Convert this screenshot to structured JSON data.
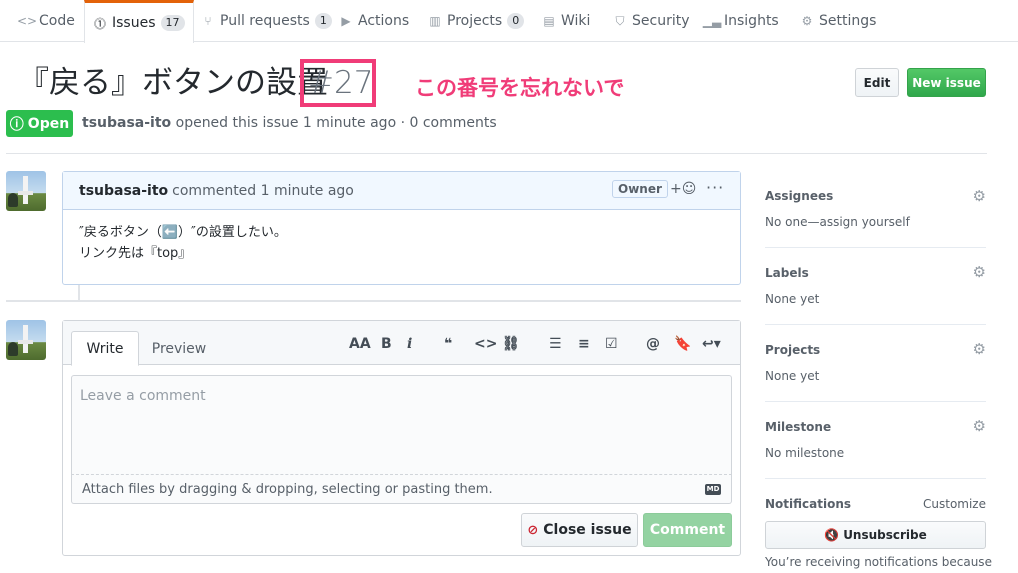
{
  "nav": {
    "tabs": [
      {
        "label": "Code",
        "icon": "code-icon"
      },
      {
        "label": "Issues",
        "icon": "issue-opened-icon",
        "count": "17"
      },
      {
        "label": "Pull requests",
        "icon": "git-pull-request-icon",
        "count": "1"
      },
      {
        "label": "Actions",
        "icon": "play-icon"
      },
      {
        "label": "Projects",
        "icon": "project-icon",
        "count": "0"
      },
      {
        "label": "Wiki",
        "icon": "book-icon"
      },
      {
        "label": "Security",
        "icon": "shield-icon"
      },
      {
        "label": "Insights",
        "icon": "graph-icon"
      },
      {
        "label": "Settings",
        "icon": "gear-icon"
      }
    ]
  },
  "issue": {
    "title": "『戻る』ボタンの設置",
    "number": "#27",
    "annotation": "この番号を忘れないで",
    "state": "Open",
    "author": "tsubasa-ito",
    "meta_rest": " opened this issue 1 minute ago · 0 comments"
  },
  "header_buttons": {
    "edit": "Edit",
    "new_issue": "New issue"
  },
  "comment": {
    "author": "tsubasa-ito",
    "action": "commented 1 minute ago",
    "badge": "Owner",
    "react": "+☺",
    "more": "···",
    "body_line1": "″戻るボタン（⬅️）″の設置したい。",
    "body_line2": "リンク先は『top』"
  },
  "editor": {
    "tab_write": "Write",
    "tab_preview": "Preview",
    "placeholder": "Leave a comment",
    "attach_text": "Attach files by dragging & dropping, selecting or pasting them.",
    "md_badge": "MD",
    "close_button": "Close issue",
    "comment_button": "Comment",
    "toolbar": [
      "AA",
      "B",
      "i",
      "❝",
      "<>",
      "⛓",
      "☰",
      "≡",
      "☑",
      "@",
      "🔖",
      "↩▾"
    ]
  },
  "sidebar": {
    "assignees_title": "Assignees",
    "assignees_value": "No one—assign yourself",
    "labels_title": "Labels",
    "labels_value": "None yet",
    "projects_title": "Projects",
    "projects_value": "None yet",
    "milestone_title": "Milestone",
    "milestone_value": "No milestone",
    "notifications_title": "Notifications",
    "customize": "Customize",
    "unsubscribe": "Unsubscribe",
    "notif_text": "You’re receiving notifications because"
  },
  "colors": {
    "accent": "#f03c78",
    "open_green": "#2cbe4e",
    "tab_orange": "#e36209"
  }
}
